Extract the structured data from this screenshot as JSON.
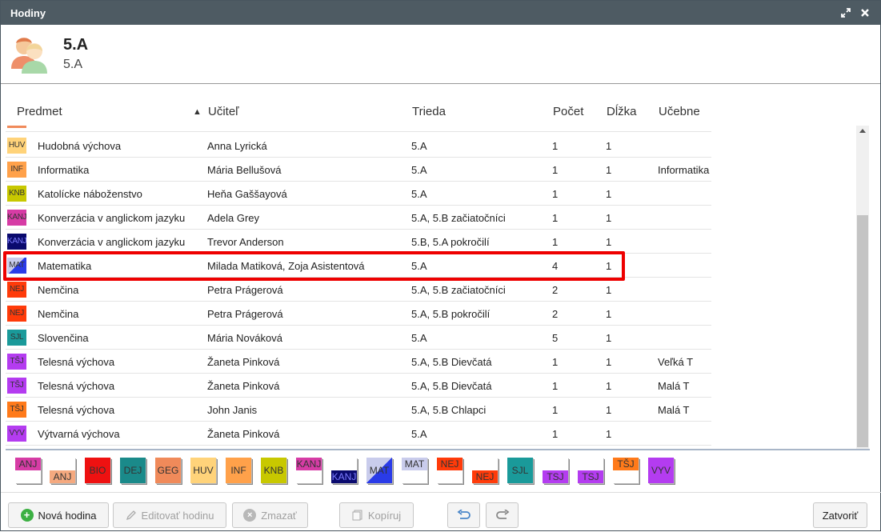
{
  "window": {
    "title": "Hodiny"
  },
  "header": {
    "title": "5.A",
    "subtitle": "5.A"
  },
  "columns": {
    "subject": "Predmet",
    "sort_indicator": "▲",
    "teacher": "Učiteľ",
    "class": "Trieda",
    "count": "Počet",
    "length": "Dĺžka",
    "rooms": "Učebne"
  },
  "rows": [
    {
      "code": "HUV",
      "color": "#ffd37a",
      "subject": "Hudobná výchova",
      "teacher": "Anna Lyrická",
      "class": "5.A",
      "count": "1",
      "length": "1",
      "room": ""
    },
    {
      "code": "INF",
      "color": "#ffa14a",
      "subject": "Informatika",
      "teacher": "Mária Bellušová",
      "class": "5.A",
      "count": "1",
      "length": "1",
      "room": "Informatika"
    },
    {
      "code": "KNB",
      "color": "#c8c800",
      "subject": "Katolícke náboženstvo",
      "teacher": "Heňa Gaššayová",
      "class": "5.A",
      "count": "1",
      "length": "1",
      "room": ""
    },
    {
      "code": "KANJ",
      "color": "#d63ca5",
      "subject": "Konverzácia v anglickom jazyku",
      "teacher": "Adela Grey",
      "class": "5.A, 5.B začiatočníci",
      "count": "1",
      "length": "1",
      "room": ""
    },
    {
      "code": "KANJ",
      "color": "#0a0a6e",
      "subject": "Konverzácia v anglickom jazyku",
      "teacher": "Trevor Anderson",
      "class": "5.B, 5.A pokročilí",
      "count": "1",
      "length": "1",
      "room": ""
    },
    {
      "code": "MAT",
      "color": "#2a3be8",
      "subject": "Matematika",
      "teacher": "Milada Matiková, Zoja Asistentová",
      "class": "5.A",
      "count": "4",
      "length": "1",
      "room": ""
    },
    {
      "code": "NEJ",
      "color": "#ff3b0a",
      "subject": "Nemčina",
      "teacher": "Petra Prágerová",
      "class": "5.A, 5.B začiatočníci",
      "count": "2",
      "length": "1",
      "room": ""
    },
    {
      "code": "NEJ",
      "color": "#ff3b0a",
      "subject": "Nemčina",
      "teacher": "Petra Prágerová",
      "class": "5.A, 5.B pokročilí",
      "count": "2",
      "length": "1",
      "room": ""
    },
    {
      "code": "SJL",
      "color": "#1a9a9a",
      "subject": "Slovenčina",
      "teacher": "Mária Nováková",
      "class": "5.A",
      "count": "5",
      "length": "1",
      "room": ""
    },
    {
      "code": "TŠJ",
      "color": "#b43cf0",
      "subject": "Telesná výchova",
      "teacher": "Žaneta Pinková",
      "class": "5.A, 5.B Dievčatá",
      "count": "1",
      "length": "1",
      "room": "Veľká T"
    },
    {
      "code": "TŠJ",
      "color": "#b43cf0",
      "subject": "Telesná výchova",
      "teacher": "Žaneta Pinková",
      "class": "5.A, 5.B Dievčatá",
      "count": "1",
      "length": "1",
      "room": "Malá T"
    },
    {
      "code": "TŠJ",
      "color": "#ff7a1a",
      "subject": "Telesná výchova",
      "teacher": "John Janis",
      "class": "5.A, 5.B Chlapci",
      "count": "1",
      "length": "1",
      "room": "Malá T"
    },
    {
      "code": "VYV",
      "color": "#b43cf0",
      "subject": "Výtvarná výchova",
      "teacher": "Žaneta Pinková",
      "class": "5.A",
      "count": "1",
      "length": "1",
      "room": ""
    }
  ],
  "palette": [
    {
      "code": "ANJ",
      "color": "#d63ca5",
      "style": "top"
    },
    {
      "code": "ANJ",
      "color": "#f5a97f",
      "style": "bottom"
    },
    {
      "code": "BIO",
      "color": "#ee1111",
      "style": "full"
    },
    {
      "code": "DEJ",
      "color": "#1a8a8a",
      "style": "full"
    },
    {
      "code": "GEG",
      "color": "#f08a5a",
      "style": "full"
    },
    {
      "code": "HUV",
      "color": "#ffd37a",
      "style": "full"
    },
    {
      "code": "INF",
      "color": "#ffa14a",
      "style": "full"
    },
    {
      "code": "KNB",
      "color": "#c8c800",
      "style": "full"
    },
    {
      "code": "KANJ",
      "color": "#d63ca5",
      "style": "top"
    },
    {
      "code": "KANJ",
      "color": "#0a0a6e",
      "style": "bottom"
    },
    {
      "code": "MAT",
      "color": "#2a3be8",
      "style": "split"
    },
    {
      "code": "MAT",
      "color": "#c9ccec",
      "style": "top"
    },
    {
      "code": "NEJ",
      "color": "#ff3b0a",
      "style": "top"
    },
    {
      "code": "NEJ",
      "color": "#ff3b0a",
      "style": "bottom"
    },
    {
      "code": "SJL",
      "color": "#1a9a9a",
      "style": "full"
    },
    {
      "code": "TSJ",
      "color": "#b43cf0",
      "style": "bottom"
    },
    {
      "code": "TSJ",
      "color": "#b43cf0",
      "style": "bottom"
    },
    {
      "code": "TŠJ",
      "color": "#ff7a1a",
      "style": "top"
    },
    {
      "code": "VYV",
      "color": "#b43cf0",
      "style": "full"
    }
  ],
  "buttons": {
    "new": "Nová hodina",
    "edit": "Editovať hodinu",
    "delete": "Zmazať",
    "copy": "Kopíruj",
    "close": "Zatvoriť"
  }
}
